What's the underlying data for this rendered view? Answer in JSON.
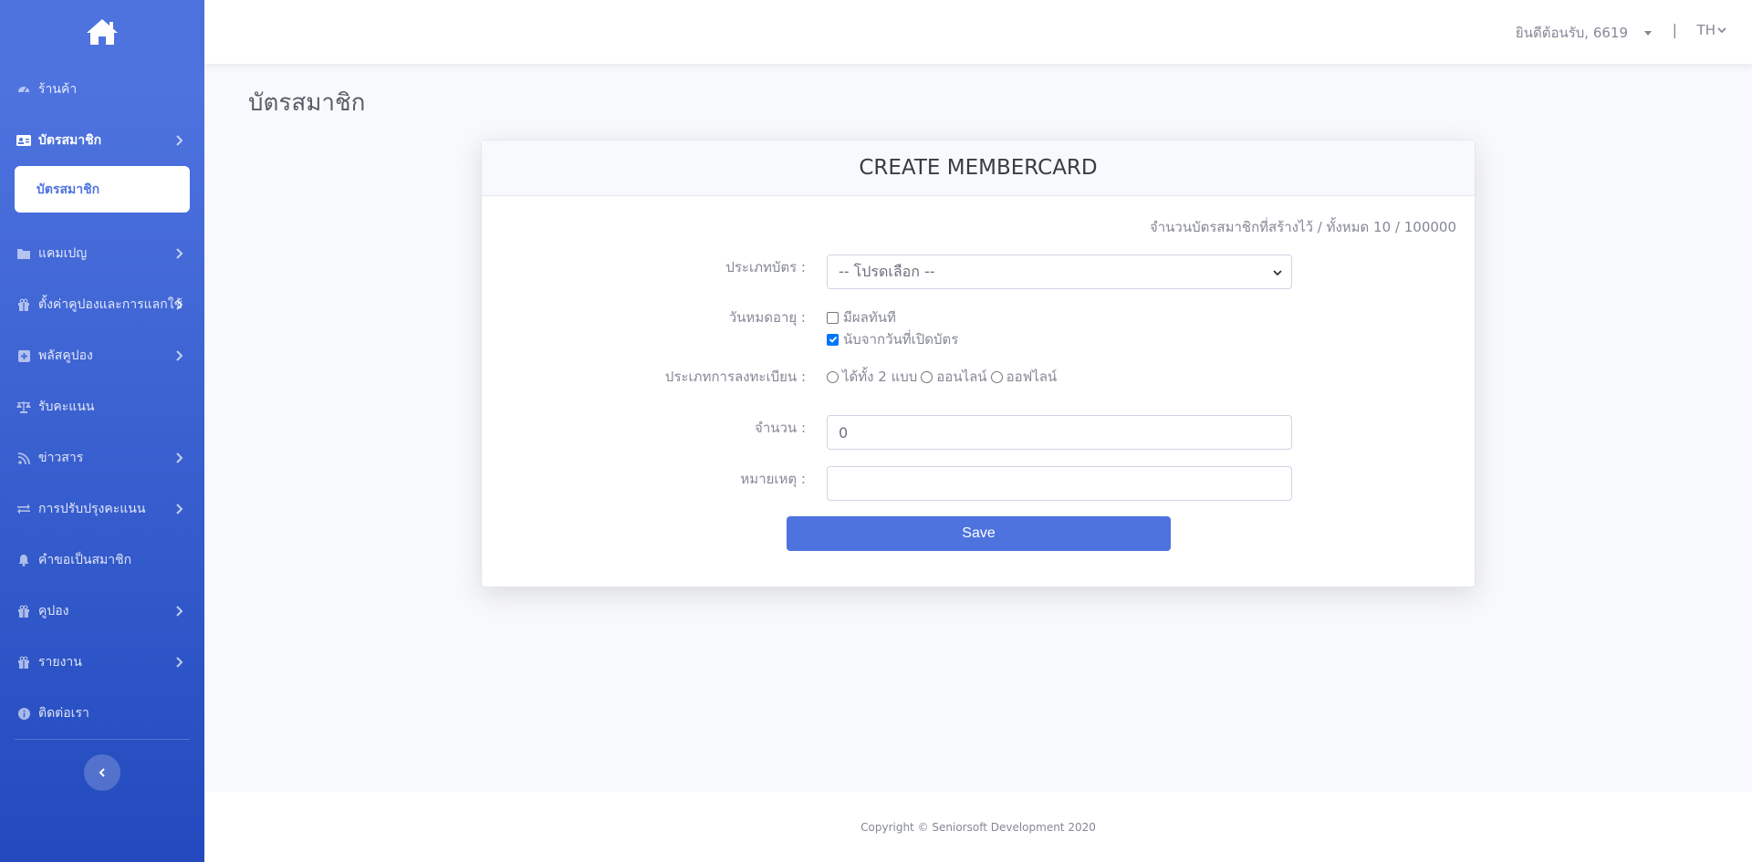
{
  "sidebar": {
    "brand_icon": "home-icon",
    "items": [
      {
        "label": "ร้านค้า",
        "icon": "tachometer-icon",
        "has_chevron": false
      },
      {
        "label": "บัตรสมาชิก",
        "icon": "id-card-icon",
        "has_chevron": true,
        "active": true
      },
      {
        "label": "แคมเปญ",
        "icon": "folder-icon",
        "has_chevron": true
      },
      {
        "label": "ตั้งค่าคูปองและการแลกใช้",
        "icon": "gift-icon",
        "has_chevron": true
      },
      {
        "label": "พลัสคูปอง",
        "icon": "plus-square-icon",
        "has_chevron": true
      },
      {
        "label": "รับคะแนน",
        "icon": "balance-scale-icon",
        "has_chevron": false
      },
      {
        "label": "ข่าวสาร",
        "icon": "rss-icon",
        "has_chevron": true
      },
      {
        "label": "การปรับปรุงคะแนน",
        "icon": "exchange-icon",
        "has_chevron": true
      },
      {
        "label": "คำขอเป็นสมาชิก",
        "icon": "bell-icon",
        "has_chevron": false
      },
      {
        "label": "คูปอง",
        "icon": "gift-icon",
        "has_chevron": true
      },
      {
        "label": "รายงาน",
        "icon": "gift-icon",
        "has_chevron": true
      },
      {
        "label": "ติดต่อเรา",
        "icon": "info-circle-icon",
        "has_chevron": false
      }
    ],
    "subitem": "บัตรสมาชิก"
  },
  "topbar": {
    "welcome": "ยินดีต้อนรับ, 6619",
    "separator": "|",
    "lang": "TH"
  },
  "page": {
    "title": "บัตรสมาชิก"
  },
  "form": {
    "header": "CREATE MEMBERCARD",
    "count_text": "จำนวนบัตรสมาชิกที่สร้างไว้ / ทั้งหมด 10 / 100000",
    "card_type_label": "ประเภทบัตร :",
    "card_type_value": "-- โปรดเลือก --",
    "expiry_label": "วันหมดอายุ :",
    "expiry_options": [
      {
        "label": "มีผลทันที",
        "checked": false
      },
      {
        "label": "นับจากวันที่เปิดบัตร",
        "checked": true
      }
    ],
    "register_type_label": "ประเภทการลงทะเบียน :",
    "register_options": [
      "ได้ทั้ง 2 แบบ",
      "ออนไลน์",
      "ออฟไลน์"
    ],
    "quantity_label": "จำนวน :",
    "quantity_value": "0",
    "note_label": "หมายเหตุ :",
    "note_value": "",
    "save_label": "Save"
  },
  "footer": {
    "copyright": "Copyright © Seniorsoft Development 2020"
  },
  "colors": {
    "primary": "#4e73df",
    "sidebar_end": "#224abe",
    "background": "#f8f9fc"
  }
}
